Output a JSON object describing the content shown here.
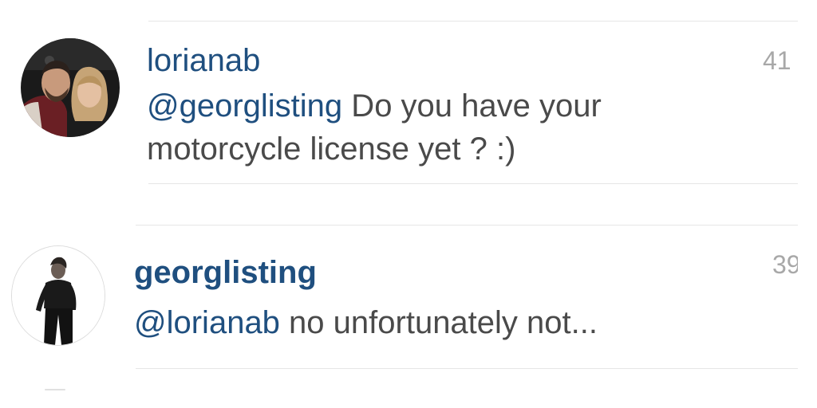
{
  "comments": [
    {
      "username": "lorianab",
      "timestamp": "41",
      "mention": "@georglisting",
      "text_line1": " Do you have your",
      "text_line2": "motorcycle license yet ? :)"
    },
    {
      "username": "georglisting",
      "timestamp": "39",
      "mention": "@lorianab",
      "text_line1": " no unfortunately not..."
    }
  ],
  "colors": {
    "username": "#1f4f7f",
    "body_text": "#4a4a4a",
    "timestamp": "#a8a8a8",
    "divider": "#e6e6e6"
  },
  "icons": {
    "avatar_1": "profile-photo-couple",
    "avatar_2": "profile-photo-man-black-shirt"
  }
}
